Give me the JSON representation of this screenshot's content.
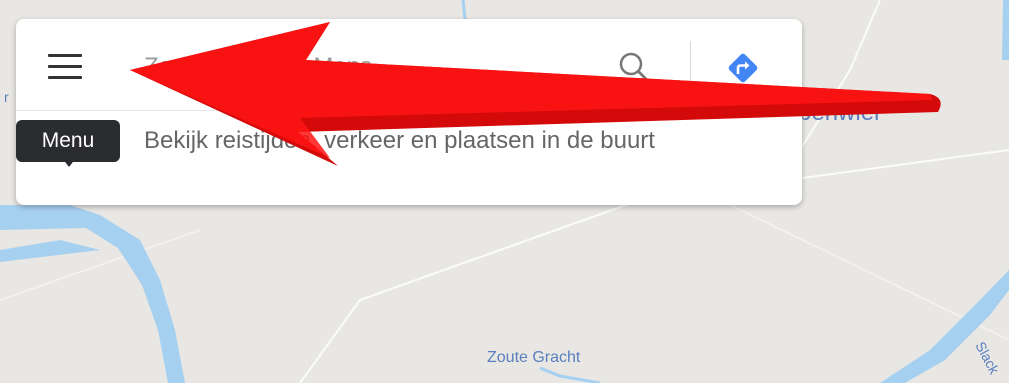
{
  "map": {
    "labels": [
      {
        "id": "zoute-gracht",
        "text": "Zoute Gracht"
      },
      {
        "id": "slack",
        "text": "Slack"
      },
      {
        "id": "benwier",
        "text": "benwier"
      }
    ],
    "colors": {
      "land": "#e9e7e4",
      "water": "#a6d0f0",
      "road": "#ffffff"
    }
  },
  "search": {
    "placeholder": "Zoek in Google Maps",
    "menu_icon": "hamburger-menu-icon",
    "search_icon": "search-icon",
    "directions_icon": "directions-icon",
    "directions_color": "#4285f4",
    "promo_text": "Bekijk reistijden, verkeer en plaatsen in de buurt"
  },
  "tooltip": {
    "text": "Menu"
  },
  "annotation": {
    "type": "arrow",
    "color": "#ff0000"
  }
}
